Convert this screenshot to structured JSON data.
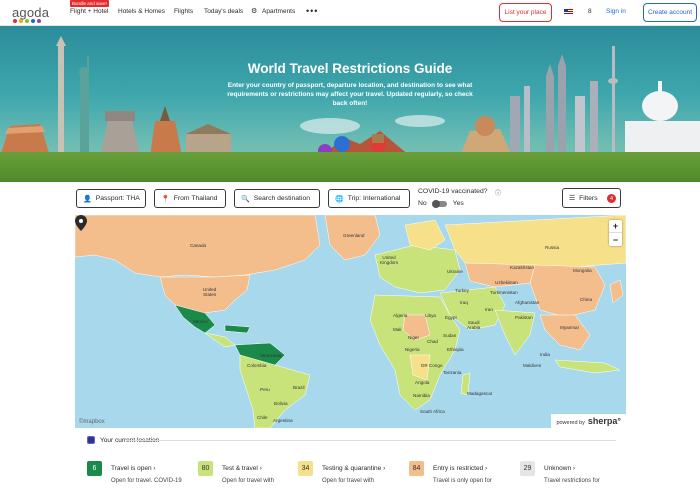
{
  "nav": {
    "logo": "agoda",
    "logo_colors": [
      "#e12d2d",
      "#f4a51c",
      "#7bc043",
      "#2067da",
      "#8e44ad"
    ],
    "bundle_badge": "Bundle and save!",
    "items": [
      "Flight + Hotel",
      "Hotels & Homes",
      "Flights",
      "Today's deals",
      "Apartments"
    ],
    "more": "•••",
    "list_place": "List your place",
    "currency": "8",
    "sign_in": "Sign in",
    "create_account": "Create account"
  },
  "hero": {
    "title": "World Travel Restrictions Guide",
    "subtitle": "Enter your country of passport, departure location, and destination to see what requirements or restrictions may affect your travel. Updated regularly, so check back often!"
  },
  "filters": {
    "passport": "Passport: THA",
    "from": "From Thailand",
    "search_placeholder": "Search destination",
    "trip": "Trip: International",
    "vaccinated_label": "COVID-19 vaccinated?",
    "toggle_no": "No",
    "toggle_yes": "Yes",
    "filters_label": "Filters",
    "filters_count": "4"
  },
  "map": {
    "labels": {
      "canada": "Canada",
      "us": "United\nStates",
      "mexico": "Mexico",
      "venezuela": "Venezuela",
      "brazil": "Brazil",
      "colombia": "Colombia",
      "peru": "Peru",
      "bolivia": "Bolivia",
      "chile": "Chile",
      "argentina": "Argentina",
      "greenland": "Greenland",
      "uk": "United\nKingdom",
      "ukraine": "Ukraine",
      "kazakhstan": "Kazakhstan",
      "russia": "Russia",
      "mongolia": "Mongolia",
      "china": "China",
      "turkey": "Turkey",
      "turkmenistan": "Turkmenistan",
      "afghanistan": "Afghanistan",
      "iran": "Iran",
      "iraq": "Iraq",
      "saudi": "Saudi\nArabia",
      "algeria": "Algeria",
      "libya": "Libya",
      "egypt": "Egypt",
      "mali": "Mali",
      "niger": "Niger",
      "chad": "Chad",
      "sudan": "Sudan",
      "nigeria": "Nigeria",
      "ethiopia": "Ethiopia",
      "drc": "DR Congo",
      "angola": "Angola",
      "tanzania": "Tanzania",
      "namibia": "Namibia",
      "south_africa": "South Africa",
      "madagascar": "Madagascar",
      "india": "India",
      "pakistan": "Pakistan",
      "maldives": "Maldives",
      "myanmar": "Myanmar",
      "uzbekistan": "Uzbekistan"
    },
    "zoom_in": "+",
    "zoom_out": "−",
    "attribution": "©mapbox",
    "powered_by": "powered by",
    "brand": "sherpa°"
  },
  "legend": {
    "your_location": "Your current location",
    "items": [
      {
        "count": "6",
        "label": "Travel is open",
        "desc": "Open for travel. COVID-19",
        "color": "#1a8a4a",
        "text": "#fff"
      },
      {
        "count": "80",
        "label": "Test & travel",
        "desc": "Open for travel with",
        "color": "#c9e37b",
        "text": "#333"
      },
      {
        "count": "34",
        "label": "Testing & quarantine",
        "desc": "Open for travel with",
        "color": "#f6e08a",
        "text": "#333"
      },
      {
        "count": "84",
        "label": "Entry is restricted",
        "desc": "Travel is only open for",
        "color": "#f3bd8c",
        "text": "#333"
      },
      {
        "count": "29",
        "label": "Unknown",
        "desc": "Travel restrictions for",
        "color": "#e5e5e5",
        "text": "#333"
      }
    ]
  }
}
